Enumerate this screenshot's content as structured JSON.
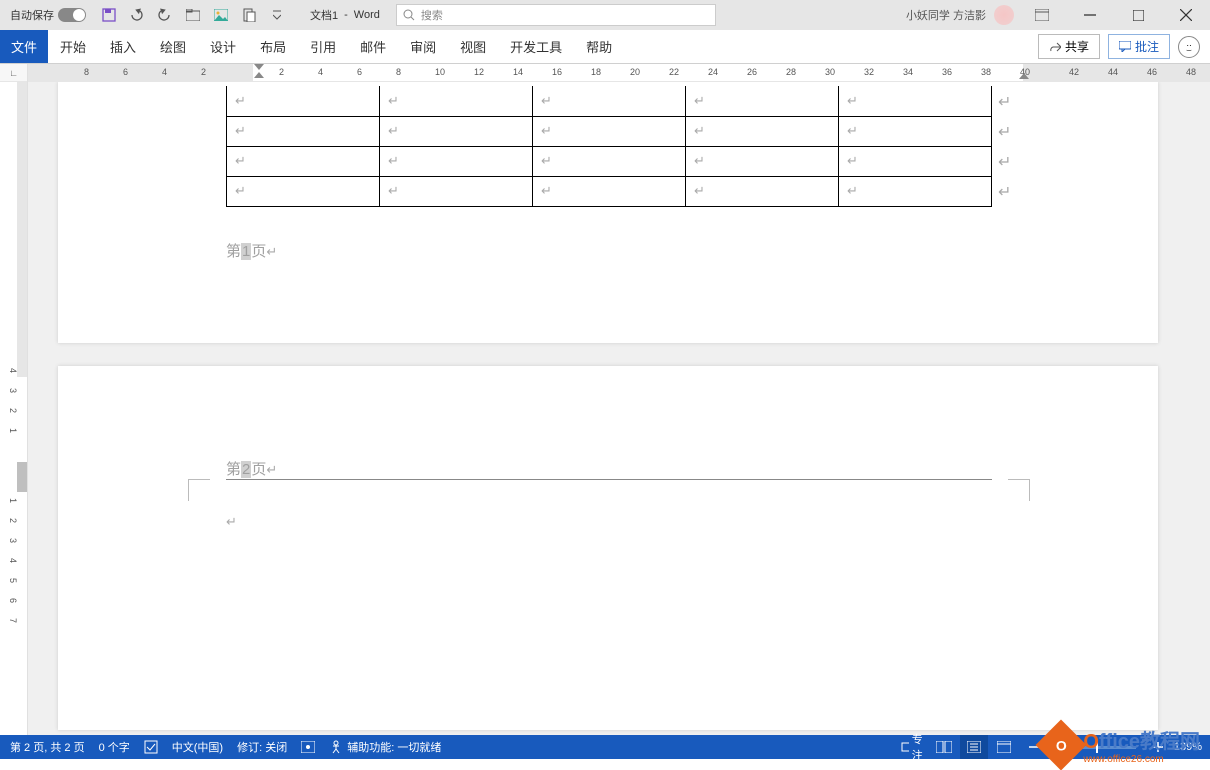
{
  "titlebar": {
    "autosave_label": "自动保存",
    "autosave_state": "关",
    "doc_name": "文档1",
    "app_name": "Word",
    "search_placeholder": "搜索",
    "user_name": "小妖同学 方洁影"
  },
  "ribbon": {
    "file": "文件",
    "tabs": [
      "开始",
      "插入",
      "绘图",
      "设计",
      "布局",
      "引用",
      "邮件",
      "审阅",
      "视图",
      "开发工具",
      "帮助"
    ],
    "share": "共享",
    "comments": "批注"
  },
  "ruler": {
    "h_marks": [
      "8",
      "6",
      "4",
      "2",
      "2",
      "4",
      "6",
      "8",
      "10",
      "12",
      "14",
      "16",
      "18",
      "20",
      "22",
      "24",
      "26",
      "28",
      "30",
      "32",
      "34",
      "36",
      "38",
      "40",
      "42",
      "44",
      "46",
      "48"
    ],
    "v_marks": [
      "4",
      "3",
      "2",
      "1",
      "1",
      "2",
      "3",
      "4",
      "5",
      "6",
      "7"
    ]
  },
  "document": {
    "page1_footer": "第1页",
    "page2_header": "第2页",
    "para_symbol": "↵"
  },
  "statusbar": {
    "page_info": "第 2 页, 共 2 页",
    "word_count": "0 个字",
    "language": "中文(中国)",
    "track": "修订: 关闭",
    "accessibility": "辅助功能: 一切就绪",
    "focus": "专注",
    "zoom": "139%"
  },
  "watermark": {
    "main_o": "O",
    "main_rest": "ffice教程网",
    "sub": "www.office26.com"
  }
}
